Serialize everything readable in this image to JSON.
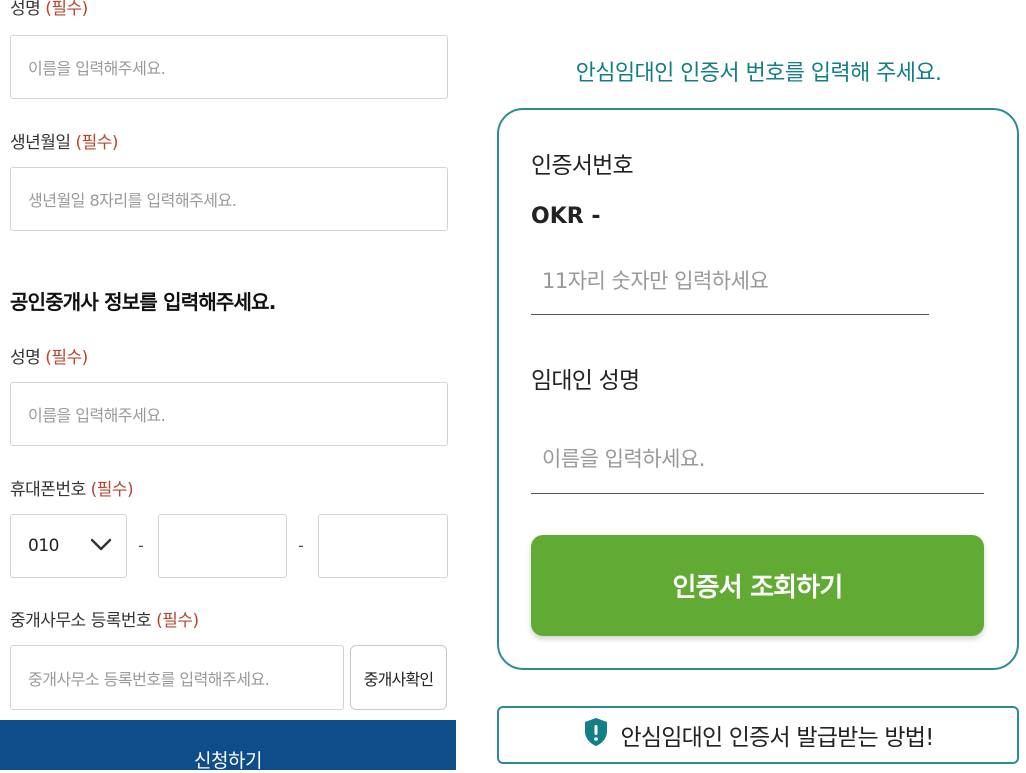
{
  "applicant": {
    "name_label": "성명",
    "name_required": "(필수)",
    "name_placeholder": "이름을 입력해주세요.",
    "birth_label": "생년월일",
    "birth_required": "(필수)",
    "birth_placeholder": "생년월일 8자리를 입력해주세요."
  },
  "agent": {
    "section_title": "공인중개사 정보를 입력해주세요.",
    "name_label": "성명",
    "name_required": "(필수)",
    "name_placeholder": "이름을 입력해주세요.",
    "phone_label": "휴대폰번호",
    "phone_required": "(필수)",
    "phone_prefix": "010",
    "phone_dash": "-",
    "office_label": "중개사무소 등록번호",
    "office_required": "(필수)",
    "office_placeholder": "중개사무소 등록번호를 입력해주세요.",
    "check_button": "중개사확인"
  },
  "apply_button": "신청하기",
  "certificate": {
    "heading": "안심임대인 인증서 번호를 입력해 주세요.",
    "number_label": "인증서번호",
    "prefix": "OKR -",
    "number_placeholder": "11자리 숫자만 입력하세요",
    "landlord_label": "임대인 성명",
    "landlord_placeholder": "이름을 입력하세요.",
    "lookup_button": "인증서 조회하기",
    "howto_button": "안심임대인 인증서 발급받는 방법!"
  },
  "colors": {
    "teal": "#127e86",
    "green": "#61ab35",
    "navy": "#0f4c8a",
    "required_red": "#b5472e"
  },
  "icons": {
    "dropdown": "chevron-down-icon",
    "info_shield": "shield-alert-icon"
  }
}
